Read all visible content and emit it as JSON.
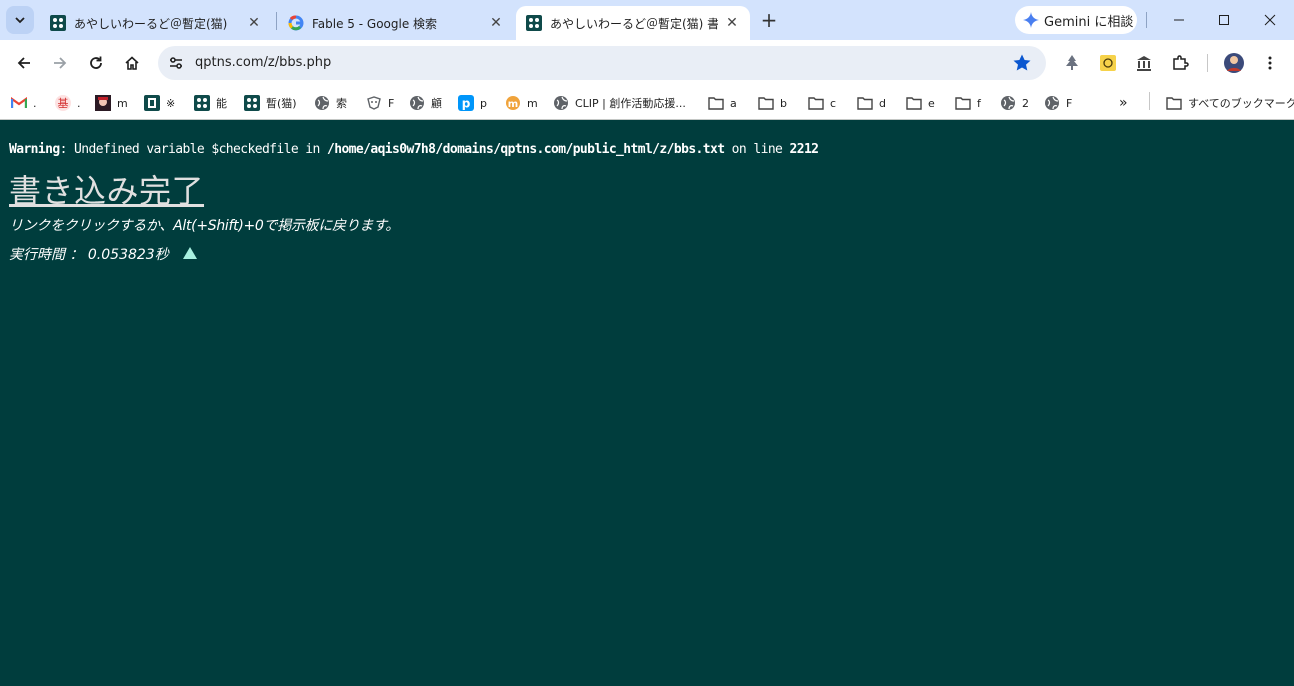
{
  "tabs": [
    {
      "title": "あやしいわーるど＠暫定(猫)",
      "active": false
    },
    {
      "title": "Fable 5 - Google 検索",
      "active": false
    },
    {
      "title": "あやしいわーるど＠暫定(猫) 書き込み完了",
      "active": true
    }
  ],
  "gemini_label": "Gemini に相談",
  "address_url": "qptns.com/z/bbs.php",
  "bookmarks": [
    {
      "label": ".",
      "icon": "gmail-icon"
    },
    {
      "label": ".",
      "icon": "kanji-icon"
    },
    {
      "label": "m",
      "icon": "avatar-icon"
    },
    {
      "label": "※",
      "icon": "site-icon"
    },
    {
      "label": "能",
      "icon": "site-icon"
    },
    {
      "label": "暫(猫)",
      "icon": "site-icon"
    },
    {
      "label": "索",
      "icon": "globe-icon"
    },
    {
      "label": "F",
      "icon": "fable-icon"
    },
    {
      "label": "顧",
      "icon": "globe-icon"
    },
    {
      "label": "p",
      "icon": "pixiv-icon"
    },
    {
      "label": "m",
      "icon": "misskey-icon"
    },
    {
      "label": "CLIP | 創作活動応援...",
      "icon": "globe-icon"
    },
    {
      "label": "a",
      "icon": "folder-icon"
    },
    {
      "label": "b",
      "icon": "folder-icon"
    },
    {
      "label": "c",
      "icon": "folder-icon"
    },
    {
      "label": "d",
      "icon": "folder-icon"
    },
    {
      "label": "e",
      "icon": "folder-icon"
    },
    {
      "label": "f",
      "icon": "folder-icon"
    },
    {
      "label": "2",
      "icon": "globe-icon"
    },
    {
      "label": "F",
      "icon": "globe-icon"
    }
  ],
  "all_bookmarks_label": "すべてのブックマーク",
  "page": {
    "warning_prefix": "Warning",
    "warning_message": ": Undefined variable $checkedfile in ",
    "warning_path": "/home/aqis0w7h8/domains/qptns.com/public_html/z/bbs.txt",
    "warning_on_line": " on line ",
    "warning_line": "2212",
    "title": "書き込み完了",
    "hint": "リンクをクリックするか、Alt(+Shift)+0で掲示板に戻ります。",
    "exec_time": "実行時間 ： 0.053823秒"
  },
  "colors": {
    "page_bg": "#003d3d",
    "tabstrip_bg": "#d3e3fd",
    "omnibox_bg": "#e9eef6",
    "star": "#0b57d0",
    "up_arrow": "#a8f0e0"
  }
}
